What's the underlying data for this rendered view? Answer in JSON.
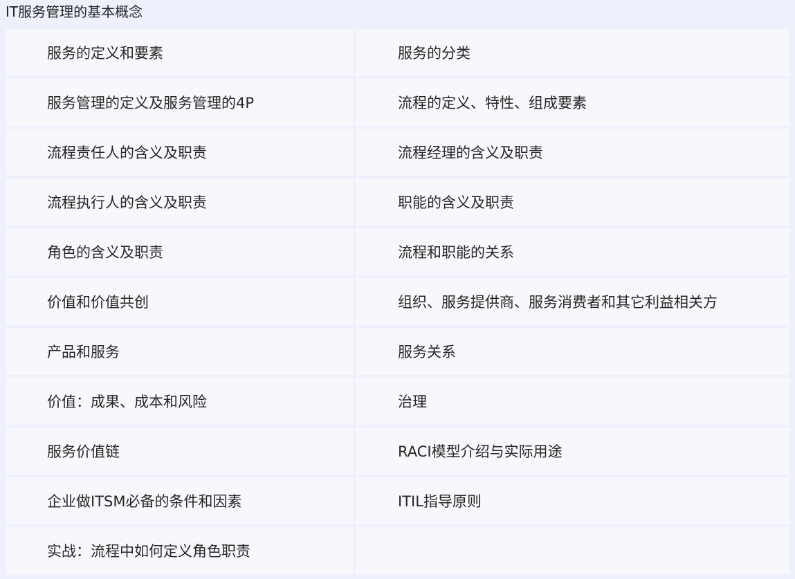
{
  "section": {
    "title": "IT服务管理的基本概念"
  },
  "table": {
    "rows": [
      {
        "left": "服务的定义和要素",
        "right": "服务的分类"
      },
      {
        "left": "服务管理的定义及服务管理的4P",
        "right": "流程的定义、特性、组成要素"
      },
      {
        "left": "流程责任人的含义及职责",
        "right": "流程经理的含义及职责"
      },
      {
        "left": "流程执行人的含义及职责",
        "right": "职能的含义及职责"
      },
      {
        "left": "角色的含义及职责",
        "right": "流程和职能的关系"
      },
      {
        "left": "价值和价值共创",
        "right": "组织、服务提供商、服务消费者和其它利益相关方"
      },
      {
        "left": "产品和服务",
        "right": "服务关系"
      },
      {
        "left": "价值：成果、成本和风险",
        "right": "治理"
      },
      {
        "left": "服务价值链",
        "right": "RACI模型介绍与实际用途"
      },
      {
        "left": "企业做ITSM必备的条件和因素",
        "right": "ITIL指导原则"
      },
      {
        "left": "实战：流程中如何定义角色职责",
        "right": ""
      }
    ]
  }
}
